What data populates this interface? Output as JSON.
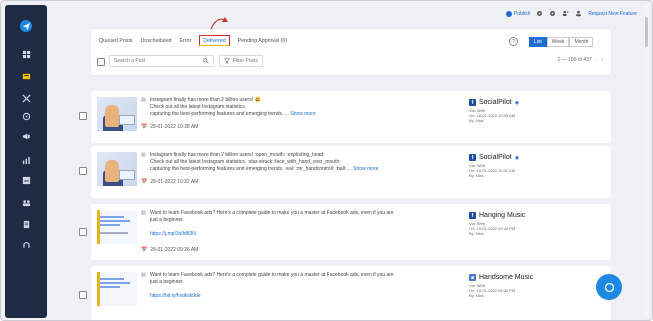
{
  "topbar": {
    "publish_label": "Publish",
    "request_label": "Request New Feature"
  },
  "tabs": [
    {
      "label": "Queued Posts"
    },
    {
      "label": "Unscheduled"
    },
    {
      "label": "Error"
    },
    {
      "label": "Delivered"
    },
    {
      "label": "Pending Approval (0)"
    }
  ],
  "views": [
    "List",
    "Week",
    "Month"
  ],
  "search": {
    "placeholder": "Search a Post"
  },
  "filter_label": "Filter Posts",
  "pager_text": "1 — 100 of 437",
  "help_glyph": "?",
  "posts": [
    {
      "text1": "Instagram finally has more than 2 billion users! 😃",
      "text2": "Check out all the latest Instagram statistics,",
      "text3": "capturing the best-performing features and emerging trends. ...",
      "show_more": "Show more",
      "date": "28-01-2022 10:38 AM",
      "account": "SocialPilot",
      "meta1": "Via: Web",
      "meta2": "On: 18-01-2022 10:35 AM",
      "meta3": "By: Nick"
    },
    {
      "text1": "Instagram finally has more than 2 billion users! :open_mouth: :exploding_head:",
      "text2": "Check out all the latest Instagram statistics, :star-struck::face_with_hand_over_mouth:",
      "text3": "capturing the best-performing features and emerging trends. :eal: :mr_handcontroll: :ball: ...",
      "show_more": "Show more",
      "date": "28-01-2022 10:32 AM",
      "account": "SocialPilot",
      "meta1": "Via: Web",
      "meta2": "On: 18-01-2022 10:31 AM",
      "meta3": "By: Nick"
    },
    {
      "text1": "Want to learn Facebook ads? Here's a complete guide to make you a master at Facebook ads, even if you are",
      "text2": "just a beginner.",
      "text3": "",
      "link": "https://j.mp/3s9d83N",
      "date": "28-01-2022 09:26 AM",
      "account": "Hanging Music",
      "meta1": "Via: Web",
      "meta2": "On: 19-01-2022 09:26 PM",
      "meta3": "By: Nick"
    },
    {
      "text1": "Want to learn Facebook ads? Here's a complete guide to make you a master at Facebook ads, even if you are",
      "text2": "just a beginner.",
      "text3": "",
      "link": "https://bit.ly/hsdksk9de",
      "date": "",
      "account": "Handsome Music",
      "meta1": "Via: Web",
      "meta2": "On: 19-01-2022 04:26 PM",
      "meta3": "By: Nick"
    }
  ]
}
